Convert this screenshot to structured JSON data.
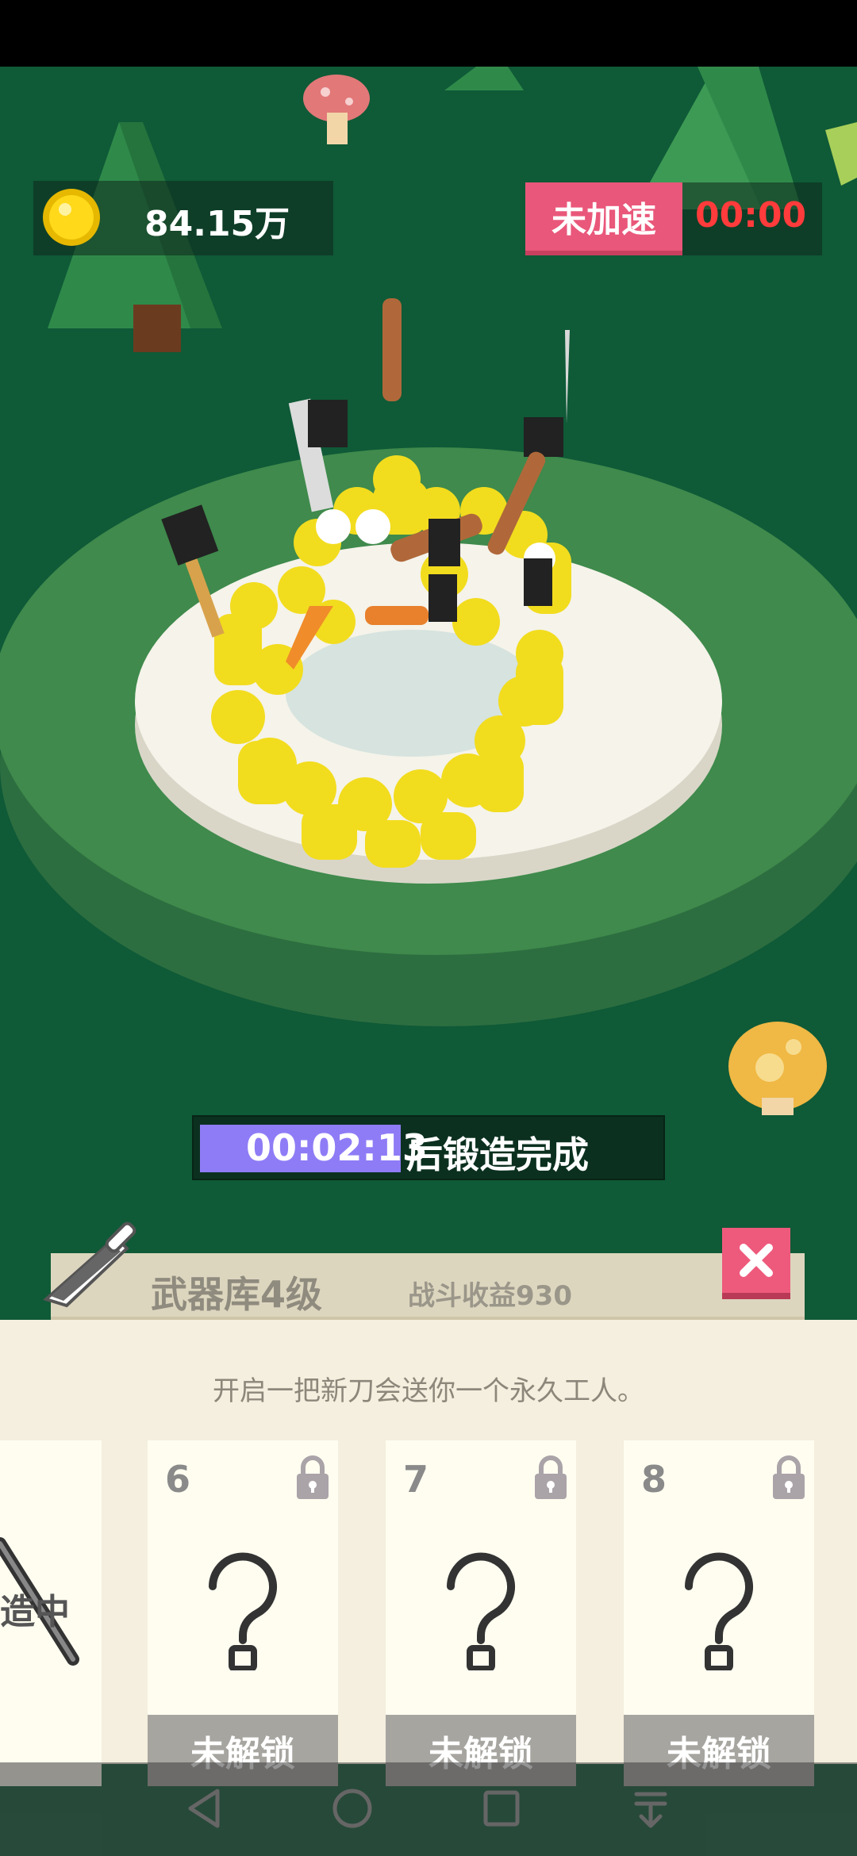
{
  "hud": {
    "coins": "84.15万",
    "speed_status": "未加速",
    "speed_timer": "00:00"
  },
  "forge": {
    "time_remaining": "00:02:13",
    "suffix": "后锻造完成",
    "progress": 0.44
  },
  "arsenal": {
    "title": "武器库4级",
    "income": "战斗收益930",
    "hint": "开启一把新刀会送你一个永久工人。",
    "partial_card_status": "造中",
    "cards": [
      {
        "number": "6",
        "status": "未解锁"
      },
      {
        "number": "7",
        "status": "未解锁"
      },
      {
        "number": "8",
        "status": "未解锁"
      }
    ]
  },
  "icons": {
    "coin": "coin-icon",
    "knife": "knife-icon",
    "close": "close-icon",
    "lock": "lock-icon",
    "question": "question-mark-icon"
  },
  "colors": {
    "accent_pink": "#e9577a",
    "timer_red": "#ff3b3b",
    "progress_purple": "#8e7cf6",
    "grass": "#0f5a37",
    "figure_yellow": "#f2dc1e"
  }
}
